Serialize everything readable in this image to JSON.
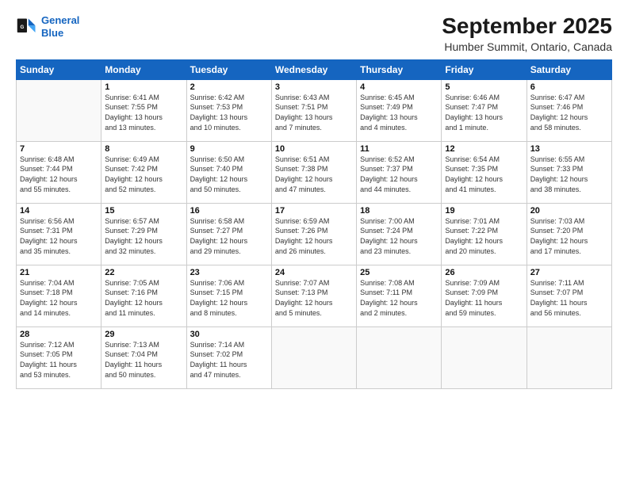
{
  "header": {
    "logo_line1": "General",
    "logo_line2": "Blue",
    "title": "September 2025",
    "subtitle": "Humber Summit, Ontario, Canada"
  },
  "weekdays": [
    "Sunday",
    "Monday",
    "Tuesday",
    "Wednesday",
    "Thursday",
    "Friday",
    "Saturday"
  ],
  "weeks": [
    [
      {
        "day": "",
        "info": ""
      },
      {
        "day": "1",
        "info": "Sunrise: 6:41 AM\nSunset: 7:55 PM\nDaylight: 13 hours\nand 13 minutes."
      },
      {
        "day": "2",
        "info": "Sunrise: 6:42 AM\nSunset: 7:53 PM\nDaylight: 13 hours\nand 10 minutes."
      },
      {
        "day": "3",
        "info": "Sunrise: 6:43 AM\nSunset: 7:51 PM\nDaylight: 13 hours\nand 7 minutes."
      },
      {
        "day": "4",
        "info": "Sunrise: 6:45 AM\nSunset: 7:49 PM\nDaylight: 13 hours\nand 4 minutes."
      },
      {
        "day": "5",
        "info": "Sunrise: 6:46 AM\nSunset: 7:47 PM\nDaylight: 13 hours\nand 1 minute."
      },
      {
        "day": "6",
        "info": "Sunrise: 6:47 AM\nSunset: 7:46 PM\nDaylight: 12 hours\nand 58 minutes."
      }
    ],
    [
      {
        "day": "7",
        "info": "Sunrise: 6:48 AM\nSunset: 7:44 PM\nDaylight: 12 hours\nand 55 minutes."
      },
      {
        "day": "8",
        "info": "Sunrise: 6:49 AM\nSunset: 7:42 PM\nDaylight: 12 hours\nand 52 minutes."
      },
      {
        "day": "9",
        "info": "Sunrise: 6:50 AM\nSunset: 7:40 PM\nDaylight: 12 hours\nand 50 minutes."
      },
      {
        "day": "10",
        "info": "Sunrise: 6:51 AM\nSunset: 7:38 PM\nDaylight: 12 hours\nand 47 minutes."
      },
      {
        "day": "11",
        "info": "Sunrise: 6:52 AM\nSunset: 7:37 PM\nDaylight: 12 hours\nand 44 minutes."
      },
      {
        "day": "12",
        "info": "Sunrise: 6:54 AM\nSunset: 7:35 PM\nDaylight: 12 hours\nand 41 minutes."
      },
      {
        "day": "13",
        "info": "Sunrise: 6:55 AM\nSunset: 7:33 PM\nDaylight: 12 hours\nand 38 minutes."
      }
    ],
    [
      {
        "day": "14",
        "info": "Sunrise: 6:56 AM\nSunset: 7:31 PM\nDaylight: 12 hours\nand 35 minutes."
      },
      {
        "day": "15",
        "info": "Sunrise: 6:57 AM\nSunset: 7:29 PM\nDaylight: 12 hours\nand 32 minutes."
      },
      {
        "day": "16",
        "info": "Sunrise: 6:58 AM\nSunset: 7:27 PM\nDaylight: 12 hours\nand 29 minutes."
      },
      {
        "day": "17",
        "info": "Sunrise: 6:59 AM\nSunset: 7:26 PM\nDaylight: 12 hours\nand 26 minutes."
      },
      {
        "day": "18",
        "info": "Sunrise: 7:00 AM\nSunset: 7:24 PM\nDaylight: 12 hours\nand 23 minutes."
      },
      {
        "day": "19",
        "info": "Sunrise: 7:01 AM\nSunset: 7:22 PM\nDaylight: 12 hours\nand 20 minutes."
      },
      {
        "day": "20",
        "info": "Sunrise: 7:03 AM\nSunset: 7:20 PM\nDaylight: 12 hours\nand 17 minutes."
      }
    ],
    [
      {
        "day": "21",
        "info": "Sunrise: 7:04 AM\nSunset: 7:18 PM\nDaylight: 12 hours\nand 14 minutes."
      },
      {
        "day": "22",
        "info": "Sunrise: 7:05 AM\nSunset: 7:16 PM\nDaylight: 12 hours\nand 11 minutes."
      },
      {
        "day": "23",
        "info": "Sunrise: 7:06 AM\nSunset: 7:15 PM\nDaylight: 12 hours\nand 8 minutes."
      },
      {
        "day": "24",
        "info": "Sunrise: 7:07 AM\nSunset: 7:13 PM\nDaylight: 12 hours\nand 5 minutes."
      },
      {
        "day": "25",
        "info": "Sunrise: 7:08 AM\nSunset: 7:11 PM\nDaylight: 12 hours\nand 2 minutes."
      },
      {
        "day": "26",
        "info": "Sunrise: 7:09 AM\nSunset: 7:09 PM\nDaylight: 11 hours\nand 59 minutes."
      },
      {
        "day": "27",
        "info": "Sunrise: 7:11 AM\nSunset: 7:07 PM\nDaylight: 11 hours\nand 56 minutes."
      }
    ],
    [
      {
        "day": "28",
        "info": "Sunrise: 7:12 AM\nSunset: 7:05 PM\nDaylight: 11 hours\nand 53 minutes."
      },
      {
        "day": "29",
        "info": "Sunrise: 7:13 AM\nSunset: 7:04 PM\nDaylight: 11 hours\nand 50 minutes."
      },
      {
        "day": "30",
        "info": "Sunrise: 7:14 AM\nSunset: 7:02 PM\nDaylight: 11 hours\nand 47 minutes."
      },
      {
        "day": "",
        "info": ""
      },
      {
        "day": "",
        "info": ""
      },
      {
        "day": "",
        "info": ""
      },
      {
        "day": "",
        "info": ""
      }
    ]
  ]
}
